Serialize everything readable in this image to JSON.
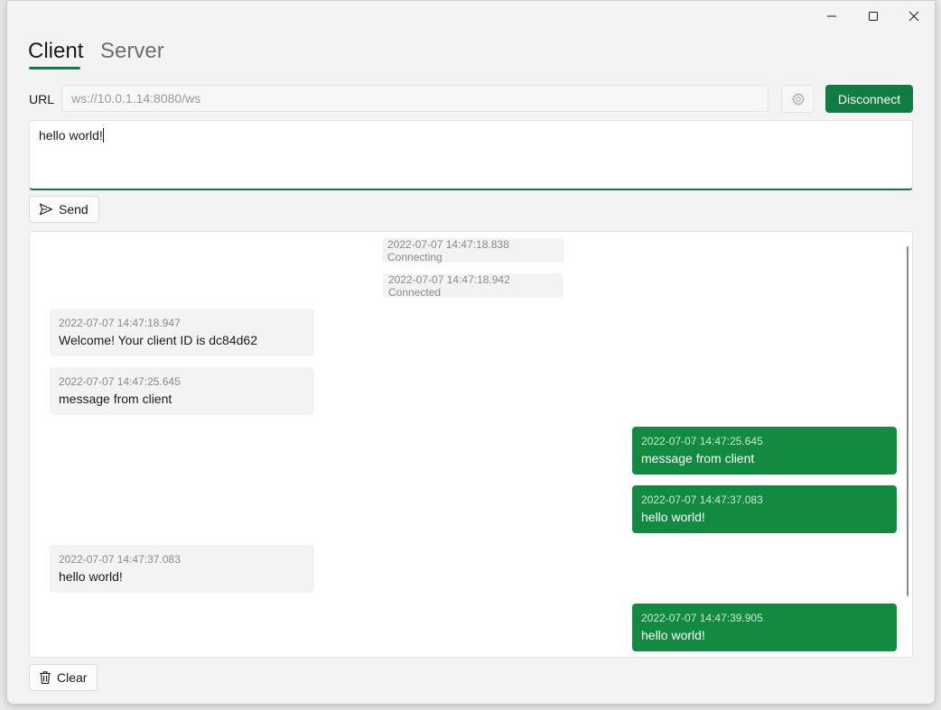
{
  "window": {
    "controls": {
      "minimize": "minimize-icon",
      "maximize": "maximize-icon",
      "close": "close-icon"
    }
  },
  "tabs": [
    {
      "label": "Client",
      "active": true
    },
    {
      "label": "Server",
      "active": false
    }
  ],
  "connection": {
    "url_label": "URL",
    "url_value": "ws://10.0.1.14:8080/ws",
    "settings_icon": "gear-icon",
    "disconnect_label": "Disconnect"
  },
  "composer": {
    "text": "hello world!",
    "send_label": "Send",
    "send_icon": "send-icon"
  },
  "log": {
    "status": [
      {
        "text": "2022-07-07 14:47:18.838 Connecting"
      },
      {
        "text": "2022-07-07 14:47:18.942 Connected"
      }
    ],
    "messages": [
      {
        "direction": "in",
        "time": "2022-07-07 14:47:18.947",
        "text": "Welcome! Your client ID is dc84d62"
      },
      {
        "direction": "in",
        "time": "2022-07-07 14:47:25.645",
        "text": "message from client"
      },
      {
        "direction": "out",
        "time": "2022-07-07 14:47:25.645",
        "text": "message from client"
      },
      {
        "direction": "out",
        "time": "2022-07-07 14:47:37.083",
        "text": "hello world!"
      },
      {
        "direction": "in",
        "time": "2022-07-07 14:47:37.083",
        "text": "hello world!"
      },
      {
        "direction": "out",
        "time": "2022-07-07 14:47:39.905",
        "text": "hello world!"
      }
    ]
  },
  "footer": {
    "clear_label": "Clear",
    "clear_icon": "trash-icon"
  },
  "colors": {
    "accent": "#107c41",
    "outgoing_bubble": "#128a3f",
    "incoming_bubble": "#f3f3f3"
  }
}
